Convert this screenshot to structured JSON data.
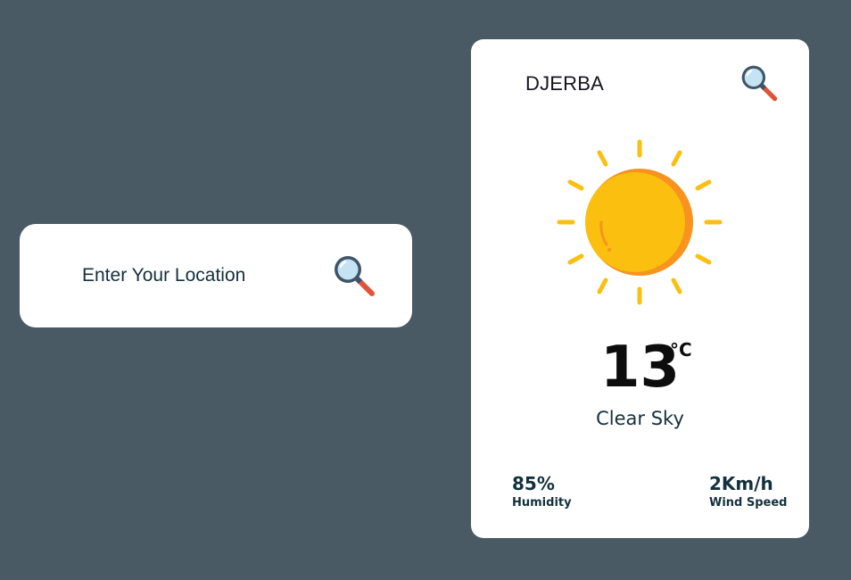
{
  "search": {
    "placeholder": "Enter Your Location",
    "button_icon": "magnifier-icon"
  },
  "weather": {
    "city": "DJERBA",
    "search_icon": "magnifier-icon",
    "condition_icon": "sun-icon",
    "temperature": "13",
    "unit": "°C",
    "description": "Clear Sky",
    "humidity": {
      "value": "85%",
      "label": "Humidity"
    },
    "wind": {
      "value": "2Km/h",
      "label": "Wind Speed"
    }
  },
  "colors": {
    "background": "#4a5a64",
    "card": "#ffffff",
    "text": "#15303d",
    "sun": "#fbbf0f",
    "sun_shade": "#f7931e",
    "magnifier_frame": "#3f5567",
    "magnifier_glass": "#c5e3f2",
    "magnifier_handle": "#e0533a"
  }
}
